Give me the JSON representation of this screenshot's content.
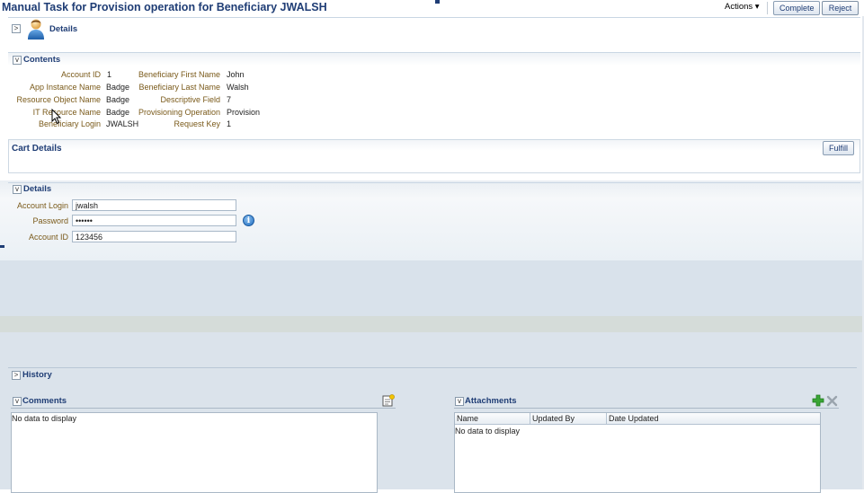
{
  "title": "Manual Task for Provision operation for Beneficiary JWALSH",
  "toolbar": {
    "actions_label": "Actions ▾",
    "complete_label": "Complete",
    "reject_label": "Reject"
  },
  "details_header": {
    "label": "Details",
    "toggle": ">"
  },
  "contents": {
    "header": "Contents",
    "toggle": "v",
    "left_fields": [
      {
        "label": "Account ID",
        "value": "1"
      },
      {
        "label": "App Instance Name",
        "value": "Badge"
      },
      {
        "label": "Resource Object Name",
        "value": "Badge"
      },
      {
        "label": "IT Resource Name",
        "value": "Badge"
      },
      {
        "label": "Beneficiary Login",
        "value": "JWALSH"
      }
    ],
    "right_fields": [
      {
        "label": "Beneficiary First Name",
        "value": "John"
      },
      {
        "label": "Beneficiary Last Name",
        "value": "Walsh"
      },
      {
        "label": "Descriptive Field",
        "value": "7"
      },
      {
        "label": "Provisioning Operation",
        "value": "Provision"
      },
      {
        "label": "Request Key",
        "value": "1"
      }
    ]
  },
  "cart": {
    "header": "Cart Details",
    "fulfill_label": "Fulfill"
  },
  "form_details": {
    "header": "Details",
    "toggle": "v",
    "account_login": {
      "label": "Account Login",
      "value": "jwalsh"
    },
    "password": {
      "label": "Password",
      "value": "••••••"
    },
    "account_id": {
      "label": "Account ID",
      "value": "123456"
    },
    "info_glyph": "i"
  },
  "history": {
    "header": "History",
    "toggle": ">"
  },
  "comments": {
    "header": "Comments",
    "toggle": "v",
    "empty_text": "No data to display"
  },
  "attachments": {
    "header": "Attachments",
    "toggle": "v",
    "columns": [
      "Name",
      "Updated By",
      "Date Updated"
    ],
    "empty_text": "No data to display"
  },
  "icons": {
    "user": "user-icon",
    "info": "info-icon",
    "add_comment": "add-comment-icon",
    "add": "add-icon",
    "delete": "delete-icon",
    "cursor": "mouse-cursor-icon"
  }
}
